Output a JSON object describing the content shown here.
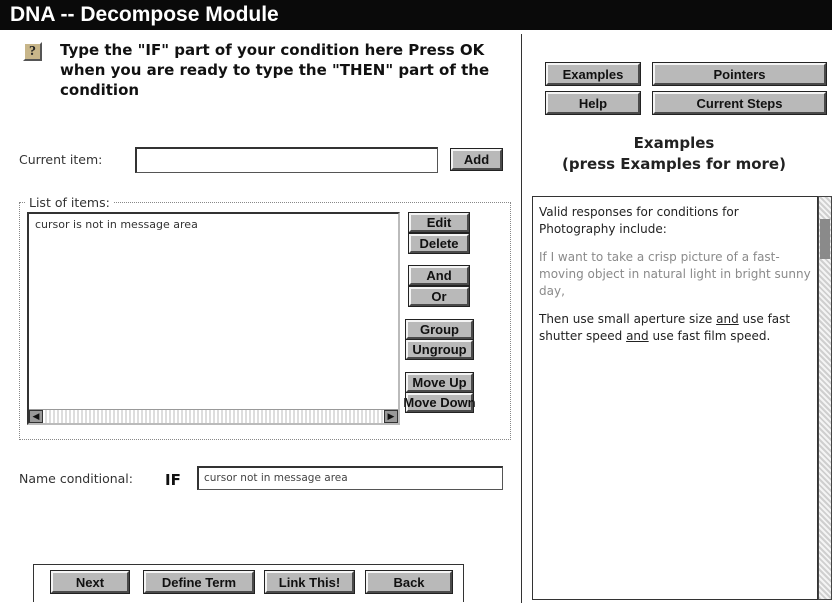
{
  "window": {
    "title": "DNA -- Decompose Module"
  },
  "instruction": {
    "help_icon": "?",
    "text": "Type the \"IF\" part of your condition here  Press OK when you are ready to type the \"THEN\" part of the condition"
  },
  "current_item": {
    "label": "Current item:",
    "value": "",
    "add_label": "Add"
  },
  "list": {
    "legend": "List of items:",
    "items": [
      "cursor is not in message area"
    ],
    "buttons": {
      "edit": "Edit",
      "delete": "Delete",
      "and": "And",
      "or": "Or",
      "group": "Group",
      "ungroup": "Ungroup",
      "move_up": "Move Up",
      "move_down": "Move Down"
    }
  },
  "name_conditional": {
    "label": "Name conditional:",
    "keyword": "IF",
    "value": "cursor not in message area"
  },
  "bottom_buttons": {
    "next": "Next",
    "define_term": "Define Term",
    "link_this": "Link This!",
    "back": "Back"
  },
  "right_panel": {
    "buttons": {
      "examples": "Examples",
      "pointers": "Pointers",
      "help": "Help",
      "current_steps": "Current Steps"
    },
    "title": "Examples",
    "subtitle": "(press Examples for more)",
    "body": {
      "intro": "Valid responses for conditions for Photography include:",
      "example_if": "If I want to take a crisp picture of a fast-moving object in natural light in bright sunny day,",
      "then_text": {
        "part1": "Then use small aperture size ",
        "and1": "and",
        "part2": " use fast shutter speed ",
        "and2": "and",
        "part3": " use fast film speed."
      }
    }
  }
}
